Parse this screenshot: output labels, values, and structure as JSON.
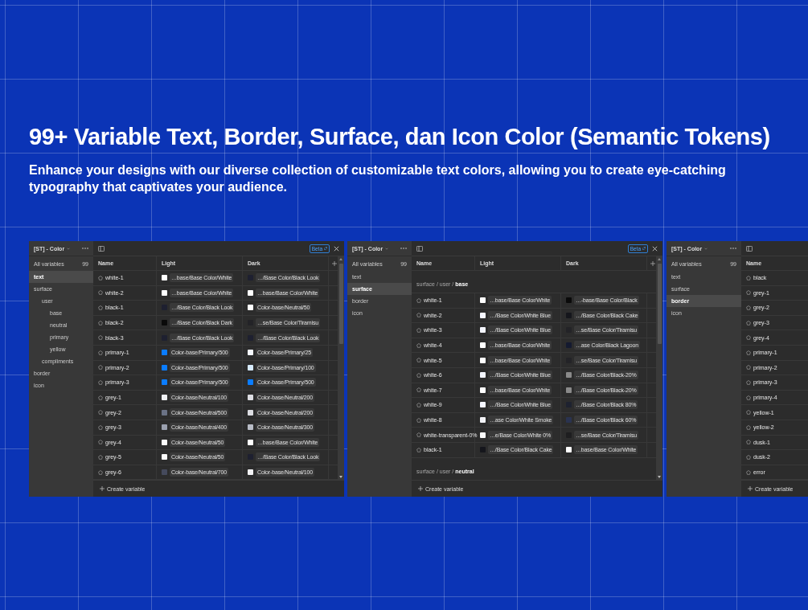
{
  "heading": "99+ Variable Text, Border, Surface, dan Icon Color (Semantic Tokens)",
  "subheading": "Enhance your designs with our diverse collection of customizable text colors, allowing you to create eye-catching typography that captivates your audience.",
  "panels": [
    {
      "collection": "[ST] - Color",
      "all_variables": {
        "label": "All variables",
        "count": "99"
      },
      "groups": [
        {
          "label": "text",
          "selected": true
        },
        {
          "label": "surface",
          "selected": false,
          "children": [
            {
              "label": "user",
              "selected": false,
              "children": [
                {
                  "label": "base",
                  "selected": false
                },
                {
                  "label": "neutral",
                  "selected": false
                },
                {
                  "label": "primary",
                  "selected": false
                },
                {
                  "label": "yellow",
                  "selected": false
                }
              ]
            },
            {
              "label": "compliments",
              "selected": false
            }
          ]
        },
        {
          "label": "border",
          "selected": false
        },
        {
          "label": "icon",
          "selected": false
        }
      ],
      "badge": "Beta",
      "closable": true,
      "add_column": true,
      "scrollbar": true,
      "columns": [
        "Name",
        "Light",
        "Dark"
      ],
      "rows": [
        {
          "kind": "variable",
          "name": "white-1",
          "values": [
            {
              "color": "#ffffff",
              "label": "…base/Base Color/White"
            },
            {
              "color": "#1e2030",
              "label": "…/Base Color/Black Look"
            }
          ]
        },
        {
          "kind": "variable",
          "name": "white-2",
          "values": [
            {
              "color": "#ffffff",
              "label": "…base/Base Color/White"
            },
            {
              "color": "#ffffff",
              "label": "…base/Base Color/White"
            }
          ]
        },
        {
          "kind": "variable",
          "name": "black-1",
          "values": [
            {
              "color": "#1e2030",
              "label": "…/Base Color/Black Look"
            },
            {
              "color": "#ffffff",
              "label": "Color-base/Neutral/50"
            }
          ]
        },
        {
          "kind": "variable",
          "name": "black-2",
          "values": [
            {
              "color": "#0a0a0a",
              "label": "…/Base Color/Black Dark"
            },
            {
              "color": "#232327",
              "label": "…se/Base Color/Tiramisu"
            }
          ]
        },
        {
          "kind": "variable",
          "name": "black-3",
          "values": [
            {
              "color": "#1e2030",
              "label": "…/Base Color/Black Look"
            },
            {
              "color": "#1e2030",
              "label": "…/Base Color/Black Look"
            }
          ]
        },
        {
          "kind": "variable",
          "name": "primary-1",
          "values": [
            {
              "color": "#0a7cff",
              "label": "Color-base/Primary/500"
            },
            {
              "color": "#f4f8ff",
              "label": "Color-base/Primary/25"
            }
          ]
        },
        {
          "kind": "variable",
          "name": "primary-2",
          "values": [
            {
              "color": "#0a7cff",
              "label": "Color-base/Primary/500"
            },
            {
              "color": "#d6eaff",
              "label": "Color-base/Primary/100"
            }
          ]
        },
        {
          "kind": "variable",
          "name": "primary-3",
          "values": [
            {
              "color": "#0a7cff",
              "label": "Color-base/Primary/500"
            },
            {
              "color": "#0a7cff",
              "label": "Color-base/Primary/500"
            }
          ]
        },
        {
          "kind": "variable",
          "name": "grey-1",
          "values": [
            {
              "color": "#eeeff2",
              "label": "Color-base/Neutral/100"
            },
            {
              "color": "#dcdde2",
              "label": "Color-base/Neutral/200"
            }
          ]
        },
        {
          "kind": "variable",
          "name": "grey-2",
          "values": [
            {
              "color": "#6a7285",
              "label": "Color-base/Neutral/500"
            },
            {
              "color": "#dcdde2",
              "label": "Color-base/Neutral/200"
            }
          ]
        },
        {
          "kind": "variable",
          "name": "grey-3",
          "values": [
            {
              "color": "#9aa0af",
              "label": "Color-base/Neutral/400"
            },
            {
              "color": "#b8bcc6",
              "label": "Color-base/Neutral/300"
            }
          ]
        },
        {
          "kind": "variable",
          "name": "grey-4",
          "values": [
            {
              "color": "#fafafa",
              "label": "Color-base/Neutral/50"
            },
            {
              "color": "#ffffff",
              "label": "…base/Base Color/White"
            }
          ]
        },
        {
          "kind": "variable",
          "name": "grey-5",
          "values": [
            {
              "color": "#fafafa",
              "label": "Color-base/Neutral/50"
            },
            {
              "color": "#1e2030",
              "label": "…/Base Color/Black Look"
            }
          ]
        },
        {
          "kind": "variable",
          "name": "grey-6",
          "values": [
            {
              "color": "#454a5c",
              "label": "Color-base/Neutral/700"
            },
            {
              "color": "#f2f2f4",
              "label": "Color-base/Neutral/100"
            }
          ]
        }
      ],
      "footer": "Create variable"
    },
    {
      "collection": "[ST] - Color",
      "all_variables": {
        "label": "All variables",
        "count": "99"
      },
      "groups": [
        {
          "label": "text",
          "selected": false
        },
        {
          "label": "surface",
          "selected": true
        },
        {
          "label": "border",
          "selected": false
        },
        {
          "label": "icon",
          "selected": false
        }
      ],
      "badge": "Beta",
      "closable": true,
      "add_column": true,
      "scrollbar": true,
      "columns": [
        "Name",
        "Light",
        "Dark"
      ],
      "rows": [
        {
          "kind": "group",
          "path": "surface / user / **base**"
        },
        {
          "kind": "variable",
          "name": "white-1",
          "values": [
            {
              "color": "#ffffff",
              "label": "…base/Base Color/White"
            },
            {
              "color": "#0a0a0a",
              "label": "…-base/Base Color/Black"
            }
          ]
        },
        {
          "kind": "variable",
          "name": "white-2",
          "values": [
            {
              "color": "#f4f6ff",
              "label": "…/Base Color/White Blue"
            },
            {
              "color": "#15161c",
              "label": "…/Base Color/Black Cake"
            }
          ]
        },
        {
          "kind": "variable",
          "name": "white-3",
          "values": [
            {
              "color": "#f4f6ff",
              "label": "…/Base Color/White Blue"
            },
            {
              "color": "#232327",
              "label": "…se/Base Color/Tiramisu"
            }
          ]
        },
        {
          "kind": "variable",
          "name": "white-4",
          "values": [
            {
              "color": "#ffffff",
              "label": "…base/Base Color/White"
            },
            {
              "color": "#141a30",
              "label": "…ase Color/Black Lagoon"
            }
          ]
        },
        {
          "kind": "variable",
          "name": "white-5",
          "values": [
            {
              "color": "#ffffff",
              "label": "…base/Base Color/White"
            },
            {
              "color": "#232327",
              "label": "…se/Base Color/Tiramisu"
            }
          ]
        },
        {
          "kind": "variable",
          "name": "white-6",
          "values": [
            {
              "color": "#f4f6ff",
              "label": "…/Base Color/White Blue"
            },
            {
              "color": "#8a8a8a",
              "label": "…/Base Color/Black-20%"
            }
          ]
        },
        {
          "kind": "variable",
          "name": "white-7",
          "values": [
            {
              "color": "#ffffff",
              "label": "…base/Base Color/White"
            },
            {
              "color": "#8a8a8a",
              "label": "…/Base Color/Black-20%"
            }
          ]
        },
        {
          "kind": "variable",
          "name": "white-9",
          "values": [
            {
              "color": "#f4f6ff",
              "label": "…/Base Color/White Blue"
            },
            {
              "color": "#1e2230",
              "label": "…/Base Color/Black 80%"
            }
          ]
        },
        {
          "kind": "variable",
          "name": "white-8",
          "values": [
            {
              "color": "#f2f3f7",
              "label": "…ase Color/White Smoke"
            },
            {
              "color": "#2a3350",
              "label": "…/Base Color/Black 60%"
            }
          ]
        },
        {
          "kind": "variable",
          "name": "white-transparent-0%",
          "values": [
            {
              "color": "#f8f8f8",
              "label": "…e/Base Color/White 0%"
            },
            {
              "color": "#1e1e20",
              "label": "…se/Base Color/Tiramisu"
            }
          ]
        },
        {
          "kind": "variable",
          "name": "black-1",
          "values": [
            {
              "color": "#15161c",
              "label": "…/Base Color/Black Cake"
            },
            {
              "color": "#ffffff",
              "label": "…base/Base Color/White"
            }
          ]
        },
        {
          "kind": "group",
          "path": "surface / user / **neutral**"
        }
      ],
      "footer": "Create variable"
    },
    {
      "collection": "[ST] - Color",
      "all_variables": {
        "label": "All variables",
        "count": "99"
      },
      "groups": [
        {
          "label": "text",
          "selected": false
        },
        {
          "label": "surface",
          "selected": false
        },
        {
          "label": "border",
          "selected": true
        },
        {
          "label": "icon",
          "selected": false
        }
      ],
      "columns": [
        "Name"
      ],
      "rows": [
        {
          "kind": "variable",
          "name": "black",
          "values": []
        },
        {
          "kind": "variable",
          "name": "grey-1",
          "values": []
        },
        {
          "kind": "variable",
          "name": "grey-2",
          "values": []
        },
        {
          "kind": "variable",
          "name": "grey-3",
          "values": []
        },
        {
          "kind": "variable",
          "name": "grey-4",
          "values": []
        },
        {
          "kind": "variable",
          "name": "primary-1",
          "values": []
        },
        {
          "kind": "variable",
          "name": "primary-2",
          "values": []
        },
        {
          "kind": "variable",
          "name": "primary-3",
          "values": []
        },
        {
          "kind": "variable",
          "name": "primary-4",
          "values": []
        },
        {
          "kind": "variable",
          "name": "yellow-1",
          "values": []
        },
        {
          "kind": "variable",
          "name": "yellow-2",
          "values": []
        },
        {
          "kind": "variable",
          "name": "dusk-1",
          "values": []
        },
        {
          "kind": "variable",
          "name": "dusk-2",
          "values": []
        },
        {
          "kind": "variable",
          "name": "error",
          "values": []
        }
      ],
      "footer": "Create variable"
    }
  ]
}
